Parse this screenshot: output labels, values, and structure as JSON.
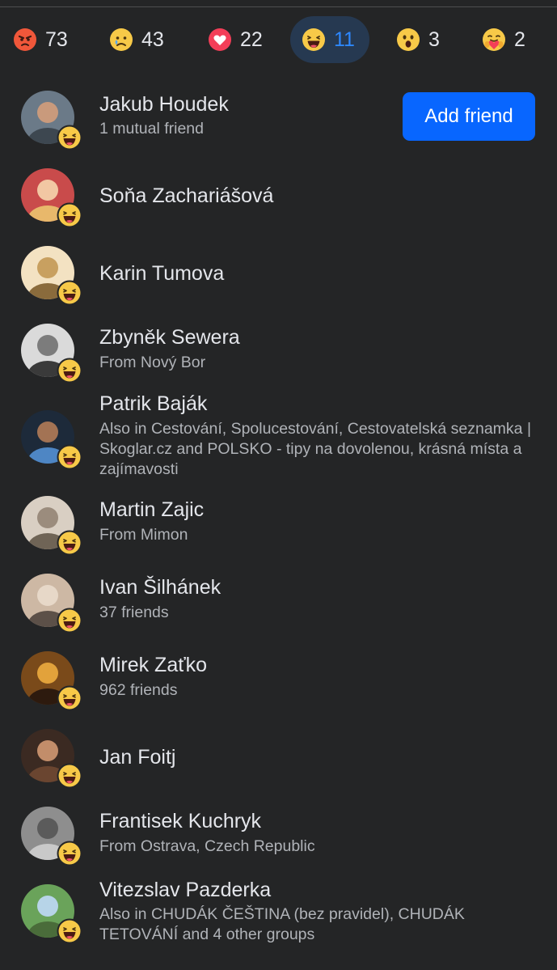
{
  "tabs": [
    {
      "icon": "angry-emoji-icon",
      "count": "73"
    },
    {
      "icon": "sad-emoji-icon",
      "count": "43"
    },
    {
      "icon": "love-heart-icon",
      "count": "22"
    },
    {
      "icon": "haha-emoji-icon",
      "count": "11",
      "active": true
    },
    {
      "icon": "wow-emoji-icon",
      "count": "3"
    },
    {
      "icon": "care-emoji-icon",
      "count": "2"
    }
  ],
  "people": [
    {
      "name": "Jakub Houdek",
      "sub": "1 mutual friend",
      "action": "Add friend"
    },
    {
      "name": "Soňa Zachariášová",
      "sub": ""
    },
    {
      "name": "Karin Tumova",
      "sub": ""
    },
    {
      "name": "Zbyněk Sewera",
      "sub": "From Nový Bor"
    },
    {
      "name": "Patrik Baják",
      "sub": "Also in Cestování, Spolucestování, Cestovatelská seznamka | Skoglar.cz and POLSKO - tipy na dovolenou, krásná místa a zajímavosti"
    },
    {
      "name": "Martin Zajic",
      "sub": "From Mimon"
    },
    {
      "name": "Ivan Šilhánek",
      "sub": "37 friends"
    },
    {
      "name": "Mirek Zaťko",
      "sub": "962 friends"
    },
    {
      "name": "Jan Foitj",
      "sub": ""
    },
    {
      "name": "Frantisek Kuchryk",
      "sub": "From Ostrava, Czech Republic"
    },
    {
      "name": "Vitezslav Pazderka",
      "sub": "Also in CHUDÁK ČEŠTINA (bez pravidel), CHUDÁK TETOVÁNÍ and 4 other groups"
    }
  ],
  "colors": {
    "accent": "#2d88ff",
    "button": "#0866ff",
    "background": "#242526"
  }
}
